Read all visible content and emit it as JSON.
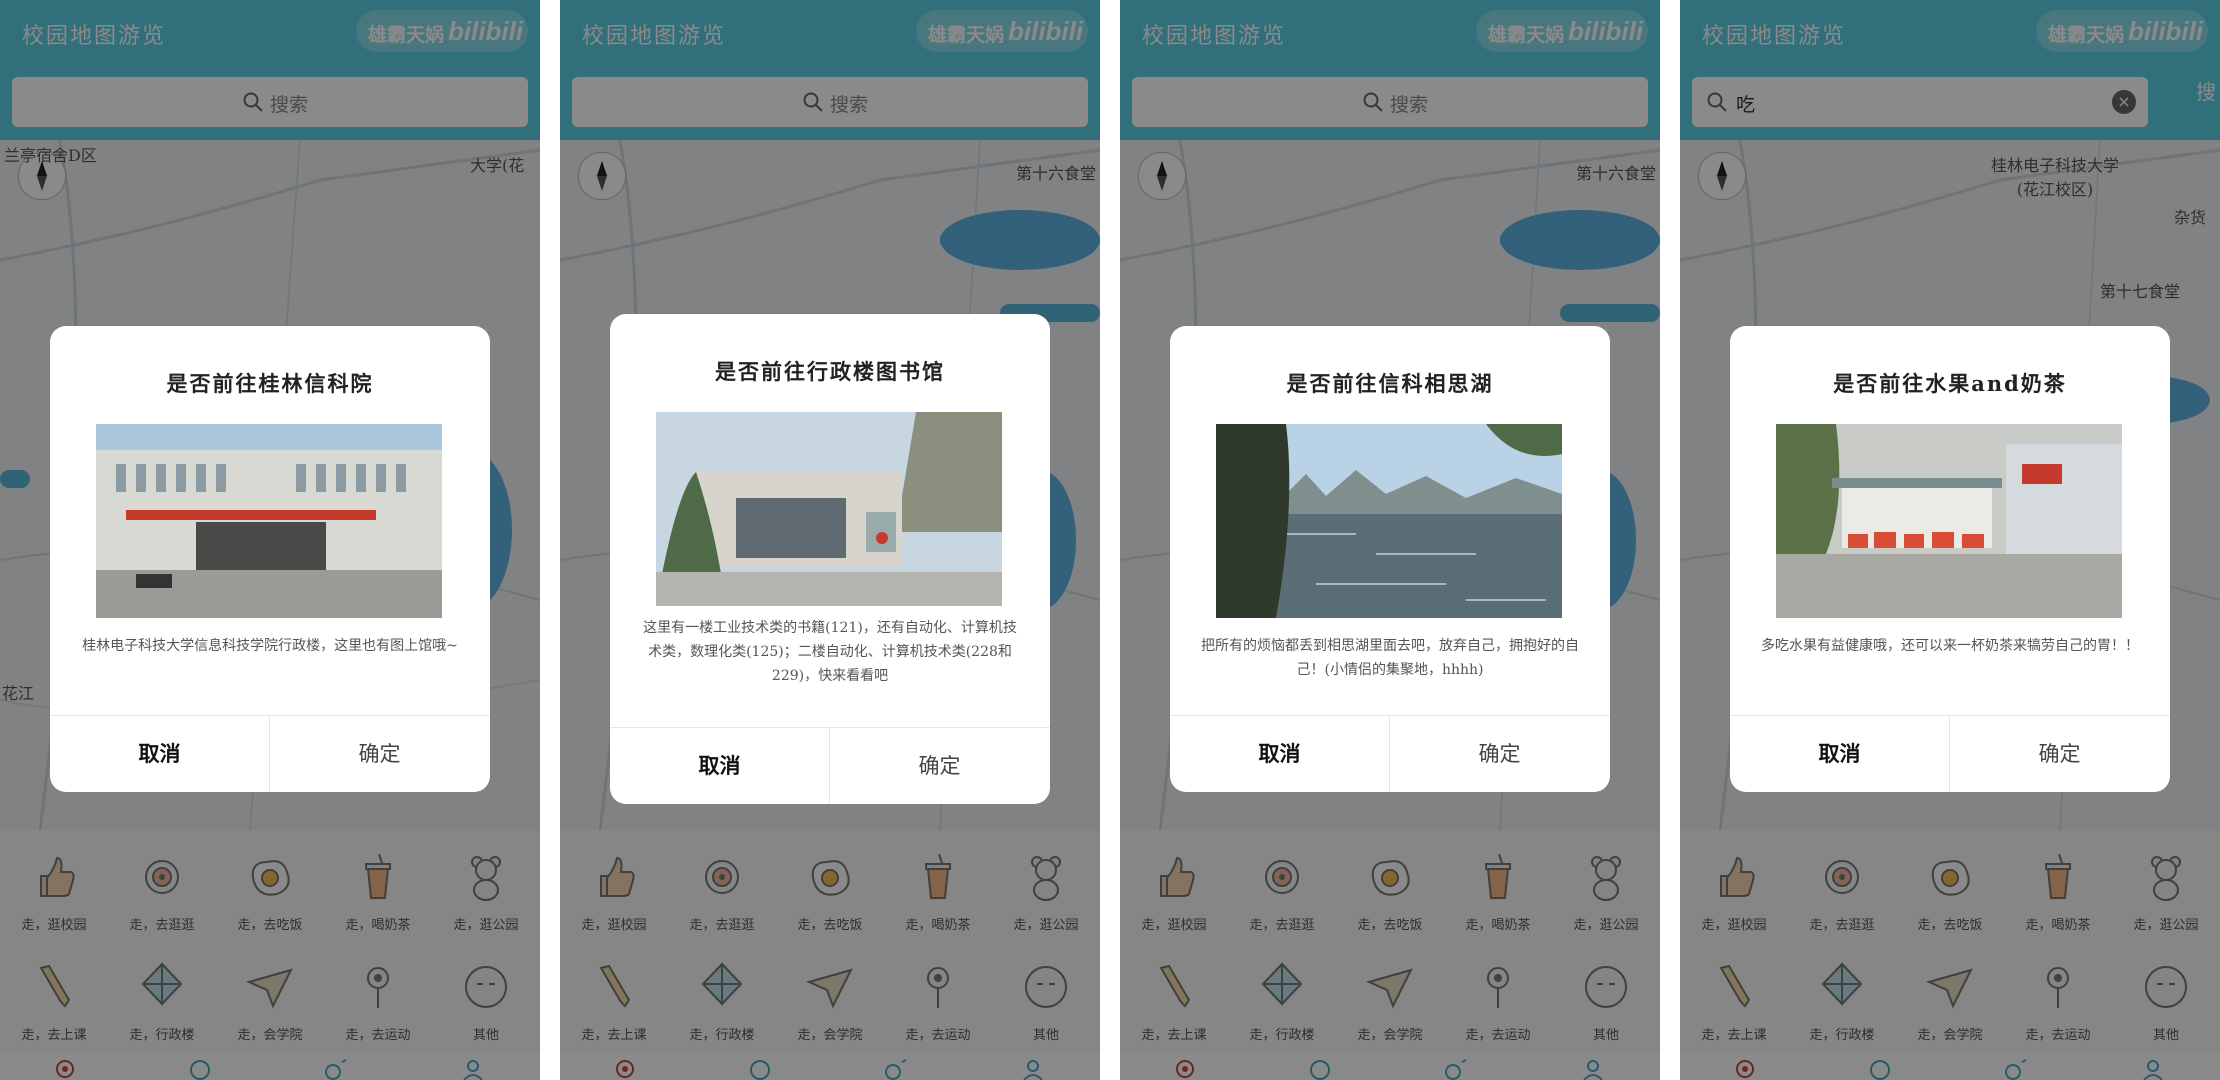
{
  "app": {
    "title": "校园地图游览",
    "watermark_text": "雄霸天娲",
    "watermark_logo": "bilibili"
  },
  "search": {
    "placeholder": "搜索",
    "query": "吃",
    "action_label": "搜"
  },
  "map_labels": {
    "dorm": "兰亭宿舍D区",
    "school": "桂林电子科技大学(花江校区)",
    "school_short": "大学(花",
    "canteen16": "第十六食堂",
    "canteen17": "第十七食堂",
    "huajiang": "花江",
    "shop": "杂货"
  },
  "categories": [
    {
      "icon": "thumbs-up-icon",
      "label": "走，逛校园"
    },
    {
      "icon": "target-icon",
      "label": "走，去逛逛"
    },
    {
      "icon": "fried-egg-icon",
      "label": "走，去吃饭"
    },
    {
      "icon": "milk-tea-icon",
      "label": "走，喝奶茶"
    },
    {
      "icon": "teddy-bear-icon",
      "label": "走，逛公园"
    },
    {
      "icon": "pencil-icon",
      "label": "走，去上课"
    },
    {
      "icon": "kite-icon",
      "label": "走，行政楼"
    },
    {
      "icon": "paper-plane-icon",
      "label": "走，会学院"
    },
    {
      "icon": "flower-icon",
      "label": "走，去运动"
    },
    {
      "icon": "face-icon",
      "label": "其他"
    }
  ],
  "nav_icons": [
    "map-pin-icon",
    "chat-icon",
    "weather-icon",
    "user-icon"
  ],
  "dialogs": [
    {
      "title": "是否前往桂林信科院",
      "description": "桂林电子科技大学信息科技学院行政楼，这里也有图上馆哦~",
      "cancel_label": "取消",
      "confirm_label": "确定"
    },
    {
      "title": "是否前往行政楼图书馆",
      "description": "这里有一楼工业技术类的书籍(121)，还有自动化、计算机技术类，数理化类(125)；二楼自动化、计算机技术类(228和229)，快来看看吧",
      "cancel_label": "取消",
      "confirm_label": "确定"
    },
    {
      "title": "是否前往信科相思湖",
      "description": "把所有的烦恼都丢到相思湖里面去吧，放弃自己，拥抱好的自己！(小情侣的集聚地，hhhh)",
      "cancel_label": "取消",
      "confirm_label": "确定"
    },
    {
      "title": "是否前往水果and奶茶",
      "description": "多吃水果有益健康哦，还可以来一杯奶茶来犒劳自己的胃！！",
      "cancel_label": "取消",
      "confirm_label": "确定"
    }
  ],
  "colors": {
    "primary": "#5bcfe4",
    "overlay": "rgba(0,0,0,0.46)",
    "lake": "#5fb3e3",
    "tag": "#59b7d8"
  }
}
